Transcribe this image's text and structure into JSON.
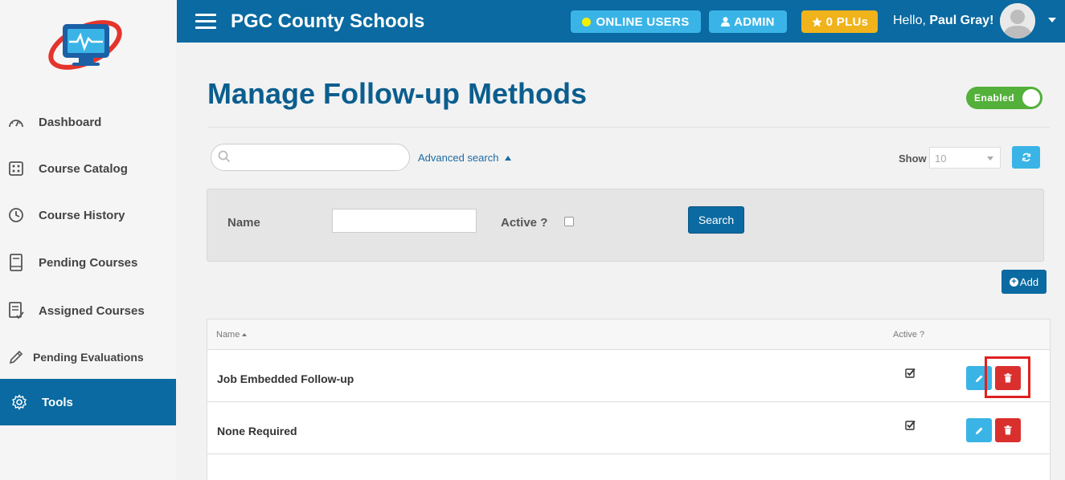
{
  "header": {
    "title": "PGC County Schools",
    "online_users": "ONLINE USERS",
    "admin": "ADMIN",
    "plus": "0 PLUs",
    "hello_prefix": "Hello, ",
    "user_name": "Paul Gray!"
  },
  "sidebar": {
    "items": [
      {
        "label": "Dashboard",
        "icon": "dashboard-icon"
      },
      {
        "label": "Course Catalog",
        "icon": "catalog-icon"
      },
      {
        "label": "Course History",
        "icon": "history-icon"
      },
      {
        "label": "Pending Courses",
        "icon": "book-icon"
      },
      {
        "label": "Assigned Courses",
        "icon": "assigned-icon"
      },
      {
        "label": "Pending Evaluations",
        "icon": "pencil-icon"
      },
      {
        "label": "Tools",
        "icon": "gear-icon",
        "active": true
      }
    ]
  },
  "main": {
    "title": "Manage Follow-up Methods",
    "toggle_label": "Enabled",
    "search_placeholder": "",
    "advanced_search": "Advanced search",
    "show_label": "Show",
    "show_value": "10",
    "filter": {
      "name_label": "Name",
      "active_label": "Active ?",
      "search_button": "Search"
    },
    "add_button": "Add",
    "table": {
      "col_name": "Name",
      "col_active": "Active ?",
      "rows": [
        {
          "name": "Job Embedded Follow-up",
          "active": true
        },
        {
          "name": "None Required",
          "active": true
        }
      ]
    }
  },
  "colors": {
    "primary": "#0a6aa1",
    "info": "#3ab4e6",
    "warning": "#f0b31b",
    "danger": "#d9302e",
    "success": "#53b03a",
    "highlight": "#e02020"
  }
}
